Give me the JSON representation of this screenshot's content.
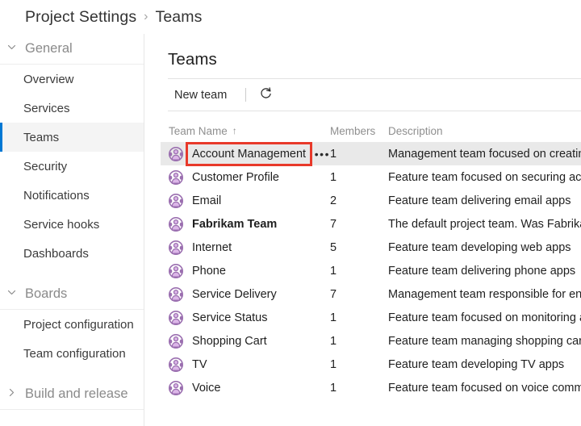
{
  "breadcrumb": {
    "root": "Project Settings",
    "separator": "›",
    "current": "Teams"
  },
  "sidebar": {
    "groups": [
      {
        "label": "General",
        "expanded": true,
        "chevron_icon": "chevron-down-icon",
        "items": [
          {
            "label": "Overview",
            "selected": false
          },
          {
            "label": "Services",
            "selected": false
          },
          {
            "label": "Teams",
            "selected": true
          },
          {
            "label": "Security",
            "selected": false
          },
          {
            "label": "Notifications",
            "selected": false
          },
          {
            "label": "Service hooks",
            "selected": false
          },
          {
            "label": "Dashboards",
            "selected": false
          }
        ]
      },
      {
        "label": "Boards",
        "expanded": true,
        "chevron_icon": "chevron-down-icon",
        "items": [
          {
            "label": "Project configuration",
            "selected": false
          },
          {
            "label": "Team configuration",
            "selected": false
          }
        ]
      },
      {
        "label": "Build and release",
        "expanded": false,
        "chevron_icon": "chevron-right-icon",
        "items": []
      }
    ]
  },
  "main": {
    "title": "Teams",
    "toolbar": {
      "new_team_label": "New team",
      "refresh_icon": "refresh-icon",
      "refresh_label": "Refresh"
    },
    "table": {
      "columns": {
        "name": "Team Name",
        "members": "Members",
        "description": "Description"
      },
      "sort_column": "name",
      "sort_arrow": "↑",
      "overflow_icon": "ellipsis-icon",
      "overflow_label": "•••",
      "avatar_icon": "team-avatar-icon",
      "rows": [
        {
          "name": "Account Management",
          "members": "1",
          "description": "Management team focused on creating an",
          "selected": true,
          "highlighted": true,
          "bold": false,
          "show_overflow": true
        },
        {
          "name": "Customer Profile",
          "members": "1",
          "description": "Feature team focused on securing account",
          "selected": false,
          "highlighted": false,
          "bold": false,
          "show_overflow": false
        },
        {
          "name": "Email",
          "members": "2",
          "description": "Feature team delivering email apps",
          "selected": false,
          "highlighted": false,
          "bold": false,
          "show_overflow": false
        },
        {
          "name": "Fabrikam Team",
          "members": "7",
          "description": "The default project team. Was Fabrikam Fi",
          "selected": false,
          "highlighted": false,
          "bold": true,
          "show_overflow": false
        },
        {
          "name": "Internet",
          "members": "5",
          "description": "Feature team developing web apps",
          "selected": false,
          "highlighted": false,
          "bold": false,
          "show_overflow": false
        },
        {
          "name": "Phone",
          "members": "1",
          "description": "Feature team delivering phone apps",
          "selected": false,
          "highlighted": false,
          "bold": false,
          "show_overflow": false
        },
        {
          "name": "Service Delivery",
          "members": "7",
          "description": "Management team responsible for ensure",
          "selected": false,
          "highlighted": false,
          "bold": false,
          "show_overflow": false
        },
        {
          "name": "Service Status",
          "members": "1",
          "description": "Feature team focused on monitoring and a",
          "selected": false,
          "highlighted": false,
          "bold": false,
          "show_overflow": false
        },
        {
          "name": "Shopping Cart",
          "members": "1",
          "description": "Feature team managing shopping cart app",
          "selected": false,
          "highlighted": false,
          "bold": false,
          "show_overflow": false
        },
        {
          "name": "TV",
          "members": "1",
          "description": "Feature team developing TV apps",
          "selected": false,
          "highlighted": false,
          "bold": false,
          "show_overflow": false
        },
        {
          "name": "Voice",
          "members": "1",
          "description": "Feature team focused on voice communic",
          "selected": false,
          "highlighted": false,
          "bold": false,
          "show_overflow": false
        }
      ]
    }
  },
  "colors": {
    "accent": "#0078d4",
    "selected_row_bg": "#e9e9e9",
    "selected_nav_bg": "#f4f4f4",
    "highlight_outline": "#e8392a",
    "avatar_purple": "#9b6fb0",
    "avatar_fill": "#dcb6e8",
    "header_text": "#8f8f8f"
  }
}
